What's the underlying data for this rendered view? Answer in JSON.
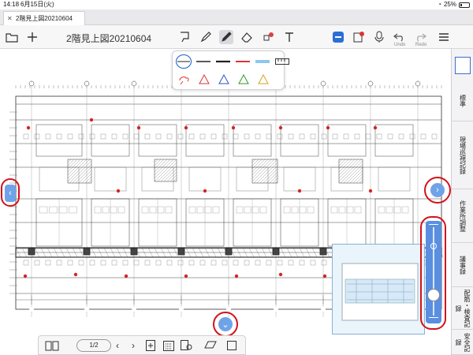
{
  "status": {
    "time": "14:18",
    "date": "6月15日(火)",
    "battery": "25%"
  },
  "tab": {
    "label": "2階見上図20210604",
    "close": "✕"
  },
  "toolbar": {
    "title": "2階見上図20210604",
    "undo_label": "Undo",
    "redo_label": "Redo"
  },
  "sidebar": {
    "tabs": [
      {
        "label": "標準"
      },
      {
        "label": "現場巡視記録"
      },
      {
        "label": "作業所調整"
      },
      {
        "label": "議事録"
      },
      {
        "label": "配筋・検査記録"
      },
      {
        "label": "安全記録"
      }
    ]
  },
  "bottom": {
    "page": "1/2"
  },
  "colors": {
    "accent": "#1a5fc8",
    "highlight_ring": "#d3131a",
    "nav_blue": "#6fa3e8",
    "slider_blue": "#5a8fe0"
  }
}
